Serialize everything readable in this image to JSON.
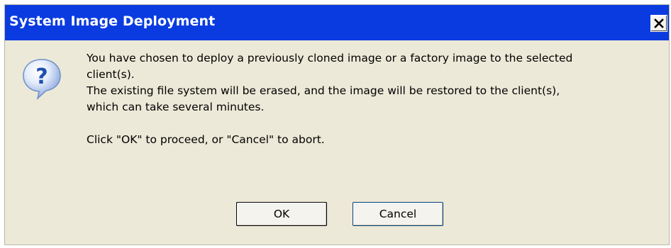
{
  "dialog": {
    "title": "System Image Deployment",
    "close_icon": "close-icon",
    "icon": "question-icon",
    "message_lines": [
      "You have chosen to deploy a previously cloned image or a factory image to the selected",
      "client(s).",
      "The existing file system will be erased, and the image will be restored to the client(s),",
      "which can take several minutes."
    ],
    "prompt": "Click \"OK\" to proceed, or \"Cancel\" to abort.",
    "buttons": {
      "ok_label": "OK",
      "cancel_label": "Cancel"
    }
  },
  "colors": {
    "titlebar": "#0a3be0",
    "dialog_bg": "#ece9d8",
    "icon_blue": "#2b62c8"
  }
}
